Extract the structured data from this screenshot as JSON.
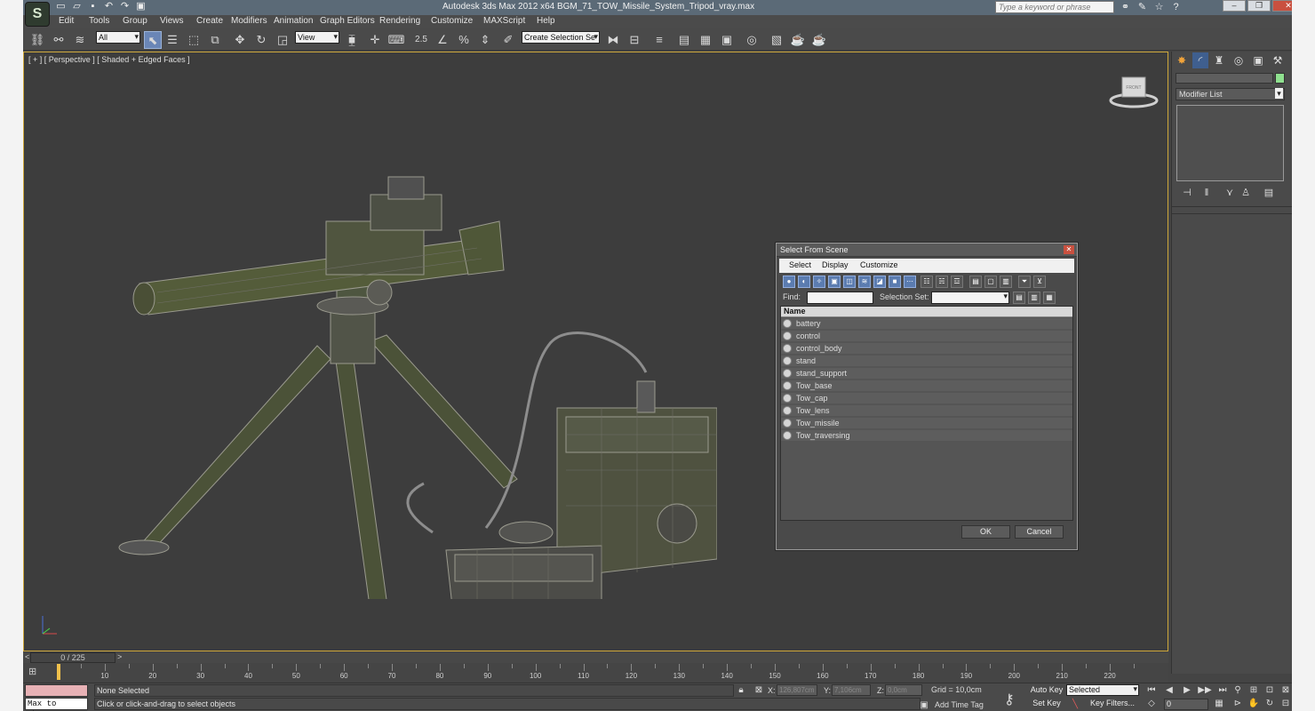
{
  "window": {
    "title": "Autodesk 3ds Max  2012 x64      BGM_71_TOW_Missile_System_Tripod_vray.max",
    "help_placeholder": "Type a keyword or phrase",
    "logo_glyph": "S",
    "qat_icons": [
      "new-icon",
      "open-icon",
      "save-icon",
      "undo-icon",
      "redo-icon",
      "project-icon"
    ],
    "help_icons": [
      "binoculars-icon",
      "wrench-icon",
      "star-icon",
      "help-icon"
    ]
  },
  "menu": [
    "Edit",
    "Tools",
    "Group",
    "Views",
    "Create",
    "Modifiers",
    "Animation",
    "Graph Editors",
    "Rendering",
    "Customize",
    "MAXScript",
    "Help"
  ],
  "toolbar": {
    "filter_value": "All",
    "ref_coord_value": "View",
    "named_selection_value": "Create Selection Se",
    "snap_label": "2.5"
  },
  "viewport": {
    "label": "[ + ] [ Perspective ] [ Shaded + Edged Faces ]",
    "viewcube_label": "FRONT",
    "accent_color": "#cfa83b"
  },
  "dialog": {
    "title": "Select From Scene",
    "menus": [
      "Select",
      "Display",
      "Customize"
    ],
    "find_label": "Find:",
    "selection_set_label": "Selection Set:",
    "column_name": "Name",
    "items": [
      "battery",
      "control",
      "control_body",
      "stand",
      "stand_support",
      "Tow_base",
      "Tow_cap",
      "Tow_lens",
      "Tow_missile",
      "Tow_traversing"
    ],
    "ok_label": "OK",
    "cancel_label": "Cancel"
  },
  "command_panel": {
    "modifier_list_label": "Modifier List",
    "object_color": "#8fe08f"
  },
  "timeslider": {
    "label": "0 / 225",
    "left_arrow": "<",
    "right_arrow": ">",
    "tick_numbers": [
      "10",
      "20",
      "30",
      "40",
      "50",
      "60",
      "70",
      "80",
      "90",
      "100",
      "110",
      "120",
      "130",
      "140",
      "150",
      "160",
      "170",
      "180",
      "190",
      "200",
      "210",
      "220"
    ]
  },
  "status": {
    "maxscript_text": "Max to Physc.",
    "selection_text": "None Selected",
    "prompt_text": "Click or click-and-drag to select objects",
    "x_label": "X:",
    "x_value": "126,807cm",
    "y_label": "Y:",
    "y_value": "7,106cm",
    "z_label": "Z:",
    "z_value": "0,0cm",
    "grid_text": "Grid = 10,0cm",
    "add_time_tag": "Add Time Tag",
    "auto_key": "Auto Key",
    "set_key": "Set Key",
    "selected_value": "Selected",
    "key_filters": "Key Filters...",
    "frame_value": "0"
  }
}
